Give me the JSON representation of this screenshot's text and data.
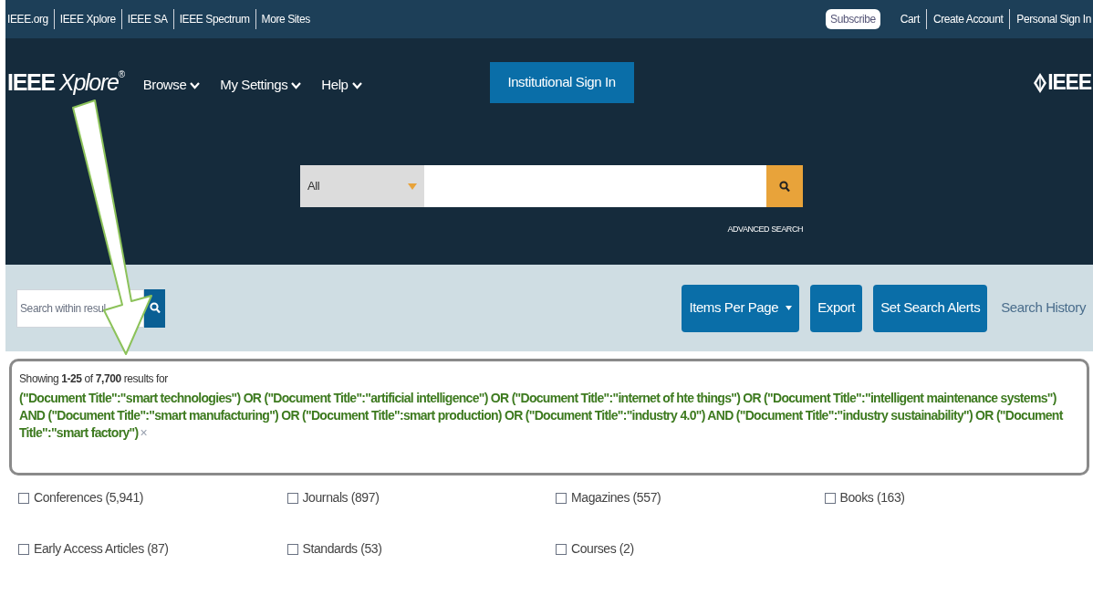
{
  "top_bar": {
    "sites": [
      "IEEE.org",
      "IEEE Xplore",
      "IEEE SA",
      "IEEE Spectrum",
      "More Sites"
    ],
    "subscribe": "Subscribe",
    "account_links": [
      "Cart",
      "Create Account",
      "Personal Sign In"
    ]
  },
  "header": {
    "logo_main": "IEEE",
    "logo_sub": "Xplore",
    "logo_mark": "®",
    "nav": [
      "Browse",
      "My Settings",
      "Help"
    ],
    "sign_in_button": "Institutional Sign In",
    "brand": "IEEE"
  },
  "search": {
    "scope": "All",
    "advanced": "ADVANCED SEARCH"
  },
  "toolbar": {
    "search_within_placeholder": "Search within resul",
    "buttons": [
      {
        "label": "Items Per Page",
        "kind": "dropdown"
      },
      {
        "label": "Export",
        "kind": "button"
      },
      {
        "label": "Set Search Alerts",
        "kind": "button"
      }
    ],
    "history_link": "Search History"
  },
  "results": {
    "summary": "Showing **1-25** of  **7,700**  results for",
    "query": "(\"Document Title\":\"smart technologies\") OR (\"Document Title\":\"artificial intelligence\") OR (\"Document Title\":\"internet of hte things\") OR (\"Document Title\":\"intelligent maintenance systems\") AND (\"Document Title\":\"smart manufacturing\") OR (\"Document Title\":smart production) OR (\"Document Title\":\"industry 4.0\") AND (\"Document Title\":\"industry sustainability\") OR (\"Document Title\":\"smart factory\")",
    "clear": "×"
  },
  "filters": [
    {
      "label": "Conferences (5,941)",
      "checked": false
    },
    {
      "label": "Journals (897)",
      "checked": false
    },
    {
      "label": "Magazines (557)",
      "checked": false
    },
    {
      "label": "Books (163)",
      "checked": false
    },
    {
      "label": "Early Access Articles (87)",
      "checked": false
    },
    {
      "label": "Standards (53)",
      "checked": false
    },
    {
      "label": "Courses (2)",
      "checked": false
    }
  ]
}
